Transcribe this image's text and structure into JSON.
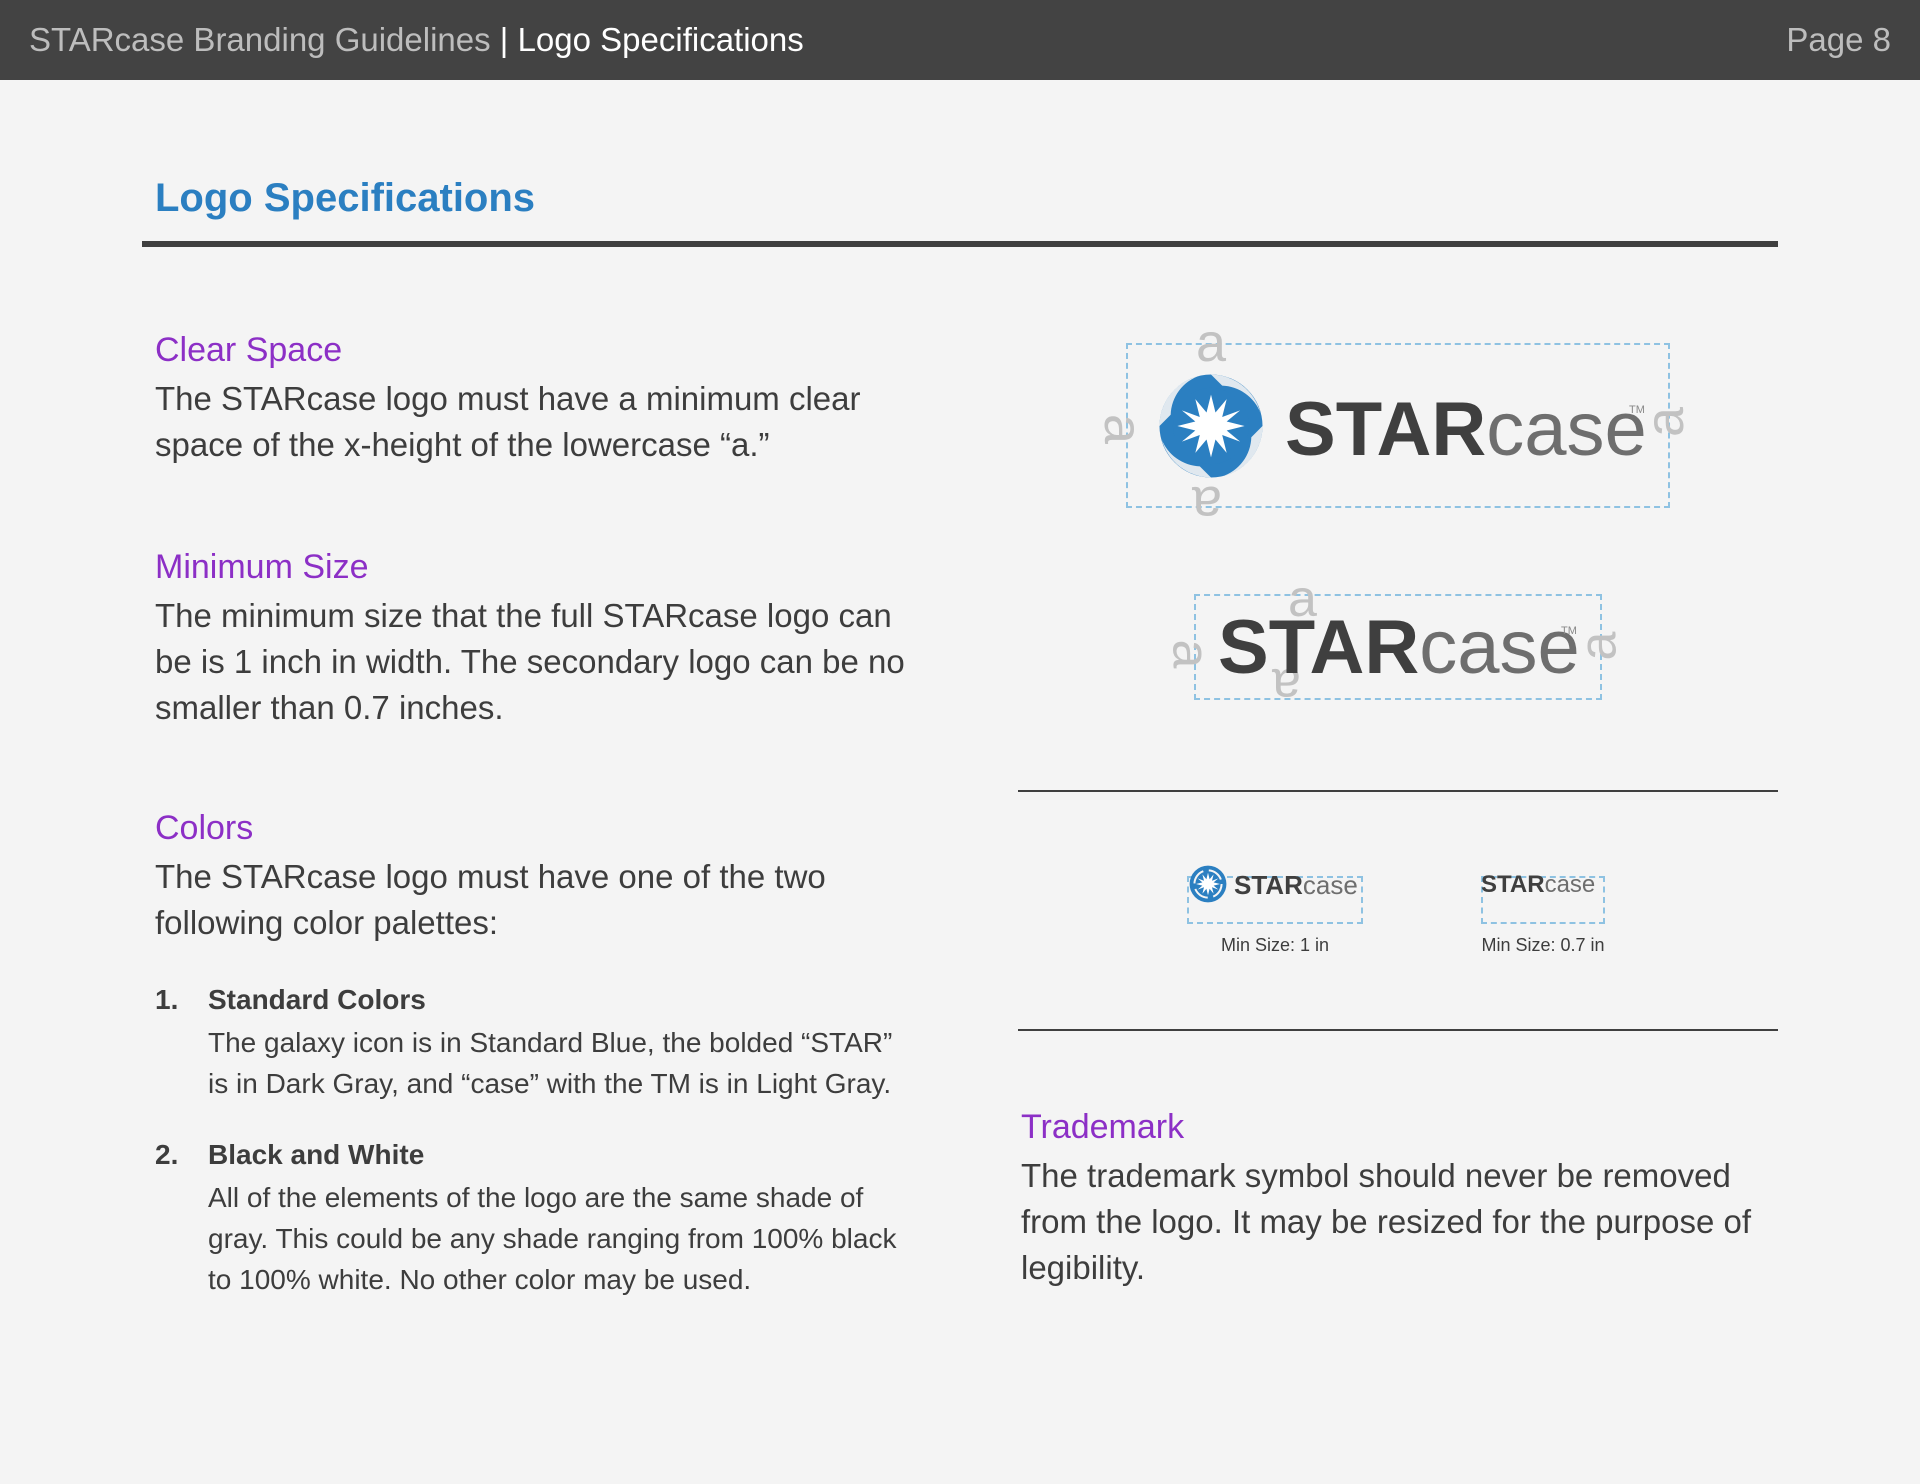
{
  "header": {
    "doc_title": "STARcase Branding Guidelines",
    "separator": " | ",
    "section": "Logo Specifications",
    "page": "Page 8"
  },
  "main": {
    "title": "Logo Specifications",
    "clear_space": {
      "heading": "Clear Space",
      "body": "The STARcase logo must have a minimum clear space of the x-height of the lowercase “a.”"
    },
    "minimum_size": {
      "heading": "Minimum Size",
      "body": "The minimum size that the full STARcase logo can be is 1 inch in width. The secondary logo can be no smaller than 0.7 inches."
    },
    "colors": {
      "heading": "Colors",
      "body": "The STARcase logo must have one of the two following color palettes:",
      "items": [
        {
          "num": "1.",
          "title": "Standard Colors",
          "text": "The galaxy icon is in Standard Blue, the bolded “STAR” is in Dark Gray, and “case” with the TM is in Light Gray."
        },
        {
          "num": "2.",
          "title": "Black and White",
          "text": "All of the elements of the logo are the same shade of gray. This could be any shade ranging from 100% black to 100% white. No other color may be used."
        }
      ]
    },
    "trademark": {
      "heading": "Trademark",
      "body": "The trademark symbol should never be removed from the logo. It may be resized for the purpose of legibility."
    }
  },
  "logos": {
    "word_star": "STAR",
    "word_case": "case",
    "tm": "TM",
    "clearspace_marker": "a",
    "min_size_full": "Min Size: 1 in",
    "min_size_secondary": "Min Size: 0.7 in"
  },
  "colors": {
    "standard_blue": "#2b7fc1",
    "dark_gray": "#3f3f3f",
    "light_gray": "#6e6e6e",
    "heading_purple": "#8c2fc6",
    "guide_blue": "#8ec2e2"
  }
}
